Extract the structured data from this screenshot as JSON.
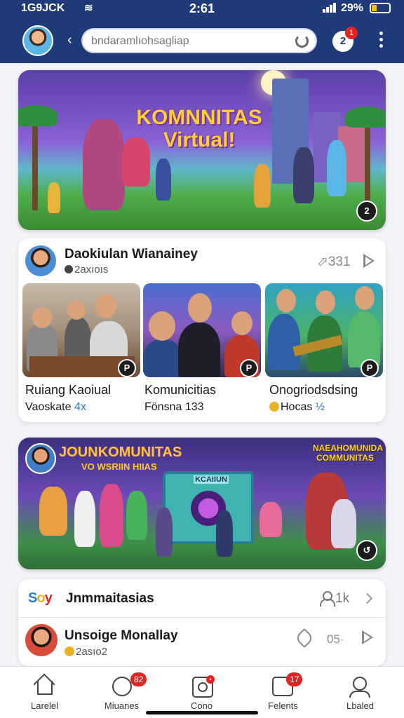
{
  "status": {
    "carrier": "1G9JCK",
    "time": "2:61",
    "battery": "29%"
  },
  "header": {
    "back_glyph": "‹",
    "search_value": "bndaramlıohsagliap",
    "notif_glyph": "2",
    "notif_badge": "1",
    "icons": [
      "avatar",
      "back-icon",
      "refresh-icon",
      "notification-icon",
      "more-icon"
    ]
  },
  "banner1": {
    "title_line1": "KOMNNITAS",
    "title_line2": "Virtual!",
    "corner_glyph": "2"
  },
  "community_card": {
    "title": "Daokiulan Wianainey",
    "subtitle": "2axıoıs",
    "count": "331",
    "thumbnails": [
      {
        "title": "Ruiang Kaoiual",
        "meta_text": "Vaoskate ",
        "meta_accent": "4x"
      },
      {
        "title": "Komunicitias",
        "meta_text": "Fönsna 133",
        "meta_accent": ""
      },
      {
        "title": "Onogriodsdsing",
        "meta_text": "Hocas ",
        "meta_accent": "½"
      }
    ],
    "thumb_corner_glyph": "P"
  },
  "banner2": {
    "title": "JOUNKOMUNITAS",
    "subtitle": "VO WSRIIN HIIAS",
    "right_title": "NAEAHOMUNIDA COMMUNITAS",
    "booth_label": "KCAIIUN",
    "corner_glyph": "↺"
  },
  "list": {
    "row1": {
      "logo": [
        "S",
        "o",
        "y"
      ],
      "title": "Jnmmaitasias",
      "count": "1k"
    },
    "row2": {
      "title": "Unsoige Monallay",
      "subtitle": "2asıo2",
      "count": "05·"
    }
  },
  "bottom_nav": [
    {
      "label": "Larelel",
      "badge": ""
    },
    {
      "label": "Miuanes",
      "badge": "82"
    },
    {
      "label": "Cono",
      "badge": "•"
    },
    {
      "label": "Felents",
      "badge": "17"
    },
    {
      "label": "Lbaled",
      "badge": ""
    }
  ],
  "colors": {
    "header_bg": "#1f3a78",
    "badge_red": "#e02424",
    "accent_blue": "#2f7ad6",
    "accent_yellow": "#e9b423"
  }
}
